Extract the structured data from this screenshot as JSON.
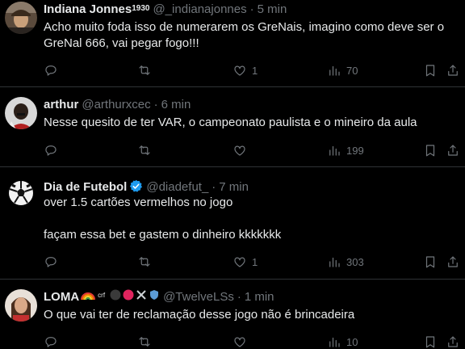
{
  "tweets": [
    {
      "name": "Indiana Jonnes",
      "name_suffix": "1930",
      "handle": "@_indianajonnes",
      "time": "5 min",
      "text": "Acho muito foda isso de numerarem os GreNais, imagino como deve ser o GreNal 666, vai pegar fogo!!!",
      "likes": "1",
      "views": "70",
      "verified": false
    },
    {
      "name": "arthur",
      "handle": "@arthurxcec",
      "time": "6 min",
      "text": "Nesse quesito de ter VAR, o campeonato paulista e o mineiro da aula",
      "likes": "",
      "views": "199",
      "verified": false
    },
    {
      "name": "Dia de Futebol",
      "handle": "@diadefut_",
      "time": "7 min",
      "text": "over 1.5 cartões vermelhos no jogo\n\nfaçam essa bet e gastem o dinheiro kkkkkkk",
      "likes": "1",
      "views": "303",
      "verified": true
    },
    {
      "name": "LOMA",
      "name_suffix": "crf",
      "handle": "@TwelveLSs",
      "time": "1 min",
      "text": "O que vai ter de reclamação desse jogo não é brincadeira",
      "likes": "",
      "views": "10",
      "verified": false
    }
  ],
  "icons": {
    "reply": "reply-icon",
    "retweet": "retweet-icon",
    "like": "like-icon",
    "views": "views-icon",
    "bookmark": "bookmark-icon",
    "share": "share-icon"
  },
  "colors": {
    "background": "#000000",
    "text": "#e7e9ea",
    "muted": "#71767b",
    "border": "#2f3336",
    "verified": "#1d9bf0"
  }
}
